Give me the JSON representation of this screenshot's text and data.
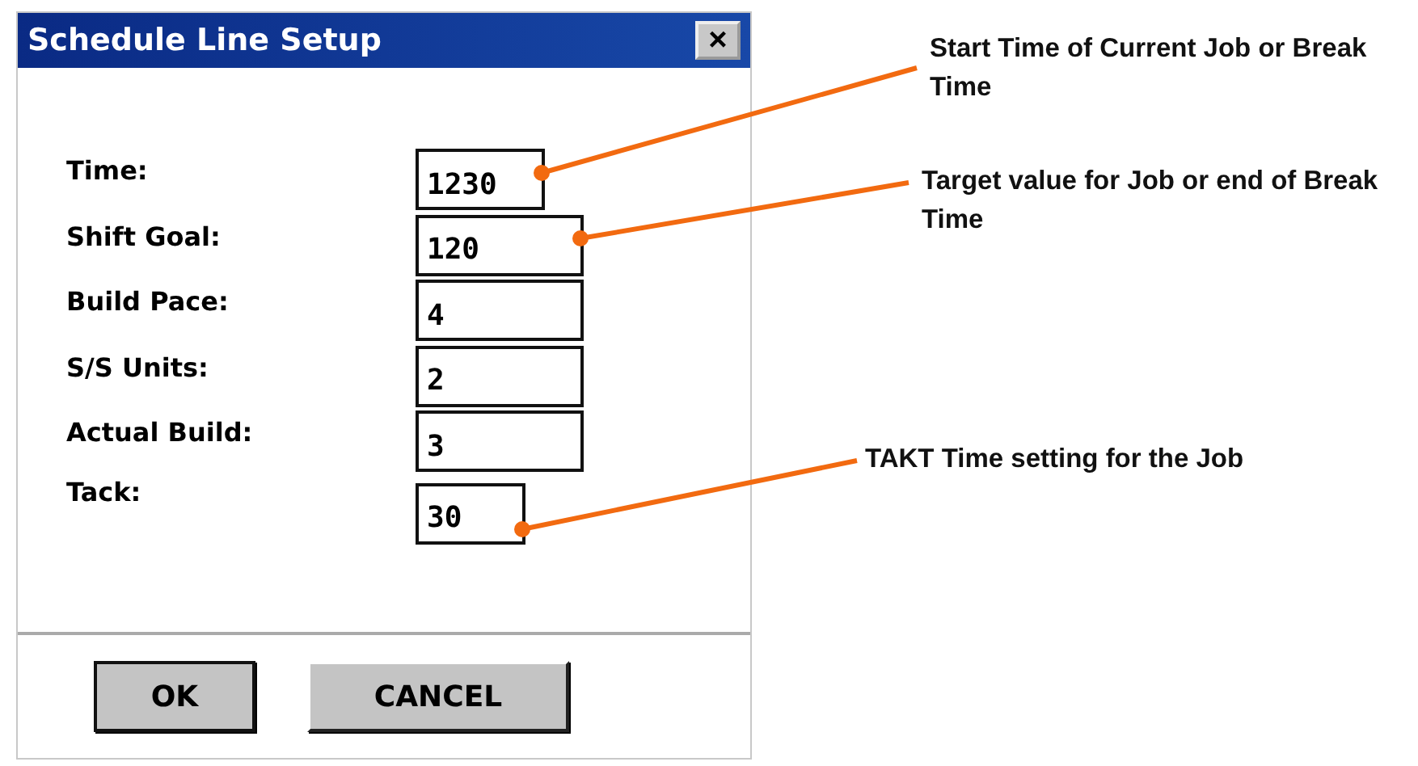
{
  "window": {
    "title": "Schedule Line Setup",
    "close": "×"
  },
  "fields": [
    {
      "label": "Time:",
      "value": "1230",
      "callout": "Start Time of Current Job or Break Time"
    },
    {
      "label": "Shift Goal:",
      "value": "120",
      "callout": "Target value for Job or end of Break Time"
    },
    {
      "label": "Build Pace:",
      "value": "4"
    },
    {
      "label": "S/S Units:",
      "value": "2"
    },
    {
      "label": "Actual Build:",
      "value": "3"
    },
    {
      "label": "Tack:",
      "value": "30",
      "callout": "TAKT Time setting for the Job"
    }
  ],
  "buttons": [
    "OK",
    "CANCEL"
  ]
}
